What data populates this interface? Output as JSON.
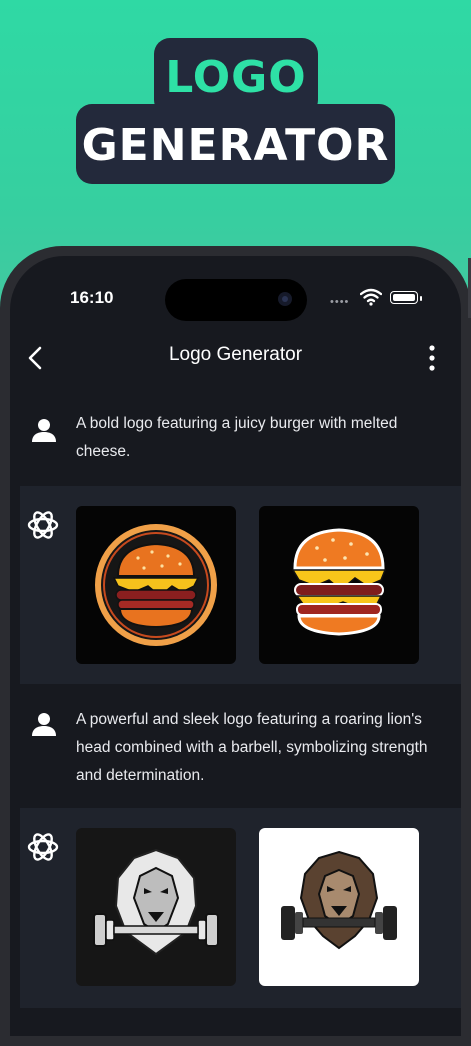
{
  "promo": {
    "title_line1": "LOGO",
    "title_line2": "GENERATOR"
  },
  "status_bar": {
    "time": "16:10"
  },
  "nav": {
    "title": "Logo Generator"
  },
  "messages": [
    {
      "role": "user",
      "text": "A bold logo featuring a juicy burger with melted cheese."
    },
    {
      "role": "assistant",
      "images": [
        "burger-logo-circle",
        "burger-logo-plain"
      ]
    },
    {
      "role": "user",
      "text": "A powerful and sleek logo featuring a roaring lion's head combined with a barbell, symbolizing strength and determination."
    },
    {
      "role": "assistant",
      "images": [
        "lion-barbell-logo-dark",
        "lion-barbell-logo-light"
      ]
    }
  ],
  "colors": {
    "accent": "#2ee1a6",
    "title_bg": "#23293b",
    "screen_bg": "#17191f",
    "ai_row_bg": "#1f232c"
  }
}
